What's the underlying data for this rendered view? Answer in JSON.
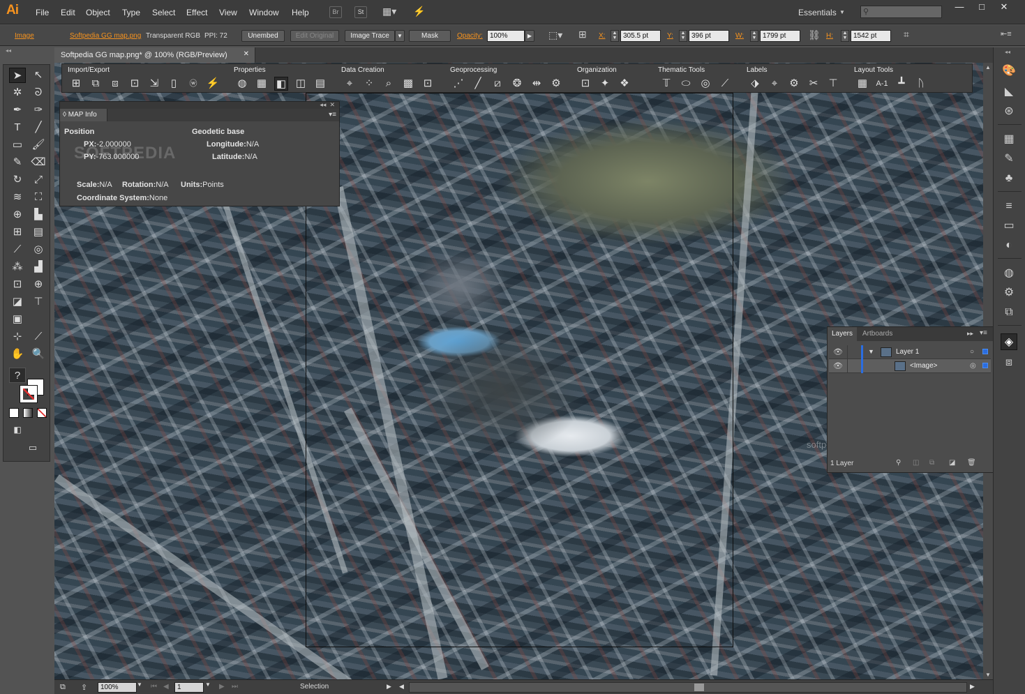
{
  "app": {
    "logo": "Ai"
  },
  "menu": [
    "File",
    "Edit",
    "Object",
    "Type",
    "Select",
    "Effect",
    "View",
    "Window",
    "Help"
  ],
  "menubar_buttons": {
    "bridge": "Br",
    "stock": "St"
  },
  "workspace": "Essentials",
  "window_controls": {
    "minimize": "—",
    "maximize": "□",
    "close": "✕"
  },
  "control_bar": {
    "selection_type": "Image",
    "file_link": "Softpedia GG map.png",
    "color_mode": "Transparent RGB",
    "ppi": "PPI: 72",
    "unembed": "Unembed",
    "edit_original": "Edit Original",
    "image_trace": "Image Trace",
    "mask": "Mask",
    "opacity_label": "Opacity:",
    "opacity_value": "100%",
    "x_label": "X:",
    "x_value": "305.5 pt",
    "y_label": "Y:",
    "y_value": "396 pt",
    "w_label": "W:",
    "w_value": "1799 pt",
    "h_label": "H:",
    "h_value": "1542 pt"
  },
  "document_tab": {
    "title": "Softpedia GG map.png* @ 100% (RGB/Preview)",
    "close": "✕"
  },
  "map_toolbar": {
    "groups": [
      {
        "label": "Import/Export"
      },
      {
        "label": "Properties"
      },
      {
        "label": "Data Creation"
      },
      {
        "label": "Geoprocessing"
      },
      {
        "label": "Organization"
      },
      {
        "label": "Thematic Tools"
      },
      {
        "label": "Labels"
      },
      {
        "label": "Layout Tools"
      }
    ]
  },
  "map_info": {
    "tab": "MAP Info",
    "position_label": "Position",
    "px_label": "PX:",
    "px_value": "-2.000000",
    "py_label": "PY:",
    "py_value": "-763.000000",
    "geodetic_label": "Geodetic base",
    "longitude_label": "Longitude:",
    "longitude_value": "N/A",
    "latitude_label": "Latitude:",
    "latitude_value": "N/A",
    "scale_label": "Scale:",
    "scale_value": "N/A",
    "rotation_label": "Rotation:",
    "rotation_value": "N/A",
    "units_label": "Units:",
    "units_value": "Points",
    "coord_label": "Coordinate System:",
    "coord_value": "None",
    "watermark": "SOFTPEDIA"
  },
  "layers_panel": {
    "tabs": [
      "Layers",
      "Artboards"
    ],
    "rows": [
      {
        "name": "Layer 1"
      },
      {
        "name": "<Image>"
      }
    ],
    "footer": "1 Layer"
  },
  "status_bar": {
    "zoom": "100%",
    "artboard_number": "1",
    "status_text": "Selection"
  },
  "canvas_watermark": "softpedia",
  "colors": {
    "accent": "#f7931e",
    "selection": "#2b6de0",
    "ui_bg": "#535353"
  }
}
